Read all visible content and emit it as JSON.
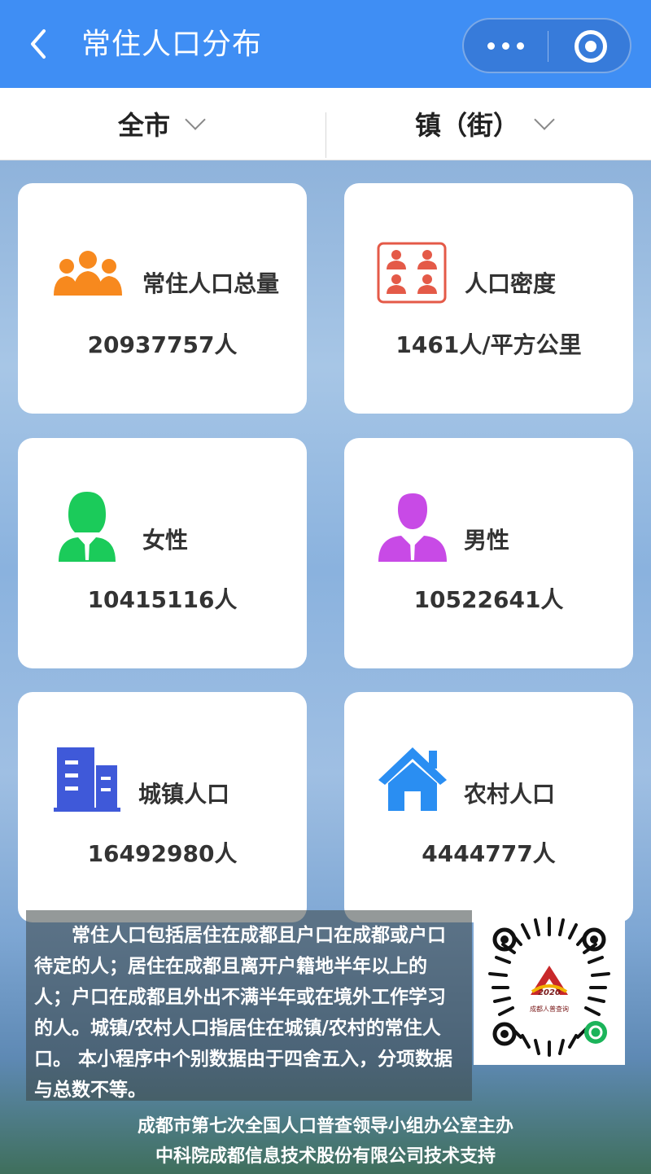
{
  "header": {
    "title": "常住人口分布"
  },
  "filters": {
    "city": "全市",
    "town": "镇（街）"
  },
  "cards": [
    {
      "label": "常住人口总量",
      "value": "20937757人",
      "icon": "people-group-icon",
      "color": "#f7891e"
    },
    {
      "label": "人口密度",
      "value": "1461人/平方公里",
      "icon": "population-density-icon",
      "color": "#e45a48"
    },
    {
      "label": "女性",
      "value": "10415116人",
      "icon": "female-user-icon",
      "color": "#1bcb5a"
    },
    {
      "label": "男性",
      "value": "10522641人",
      "icon": "male-user-icon",
      "color": "#c84ae6"
    },
    {
      "label": "城镇人口",
      "value": "16492980人",
      "icon": "building-icon",
      "color": "#3f59d9"
    },
    {
      "label": "农村人口",
      "value": "4444777人",
      "icon": "house-icon",
      "color": "#2a8ef2"
    }
  ],
  "note": "常住人口包括居住在成都且户口在成都或户口待定的人；居住在成都且离开户籍地半年以上的人；户口在成都且外出不满半年或在境外工作学习的人。城镇/农村人口指居住在城镇/农村的常住人口。 本小程序中个别数据由于四舍五入，分项数据与总数不等。",
  "qr": {
    "emblem_year": "2020",
    "emblem_caption": "成都人普查询"
  },
  "footer": {
    "line1": "成都市第七次全国人口普查领导小组办公室主办",
    "line2": "中科院成都信息技术股份有限公司技术支持"
  }
}
